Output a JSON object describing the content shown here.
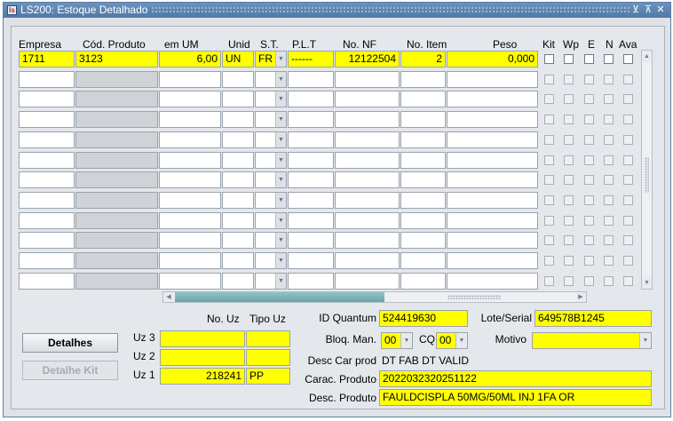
{
  "window": {
    "title": "LS200: Estoque Detalhado",
    "icon_label": "ls"
  },
  "headers": {
    "empresa": "Empresa",
    "cod_produto": "Cód. Produto",
    "em_um": "em UM",
    "unid": "Unid",
    "st": "S.T.",
    "plt": "P.L.T",
    "no_nf": "No. NF",
    "no_item": "No. Item",
    "peso": "Peso",
    "kit": "Kit",
    "wp": "Wp",
    "e": "E",
    "n": "N",
    "ava": "Ava"
  },
  "rows": [
    {
      "empresa": "1711",
      "cod_produto": "3123",
      "em_um": "6,00",
      "unid": "UN",
      "st": "FR",
      "plt": "------",
      "no_nf": "12122504",
      "no_item": "2",
      "peso": "0,000"
    }
  ],
  "bottom": {
    "no_uz_label": "No. Uz",
    "tipo_uz_label": "Tipo Uz",
    "uz3_label": "Uz 3",
    "uz2_label": "Uz 2",
    "uz1_label": "Uz 1",
    "uz1_no": "218241",
    "uz1_tipo": "PP",
    "detalhes_button": "Detalhes",
    "detalhe_kit_button": "Detalhe Kit",
    "id_quantum_label": "ID Quantum",
    "id_quantum": "524419630",
    "lote_serial_label": "Lote/Serial",
    "lote_serial": "649578B1245",
    "bloq_man_label": "Bloq. Man.",
    "bloq_man": "00",
    "cq_label": "CQ",
    "cq": "00",
    "motivo_label": "Motivo",
    "motivo": "",
    "desc_car_prod_label": "Desc Car prod",
    "desc_car_prod": "DT FAB  DT VALID",
    "carac_produto_label": "Carac. Produto",
    "carac_produto": "2022032320251122",
    "desc_produto_label": "Desc. Produto",
    "desc_produto": "FAULDCISPLA 50MG/50ML INJ 1FA OR"
  },
  "colors": {
    "highlight": "#ffff00",
    "titlebar": "#5a82ae",
    "scroll_thumb": "#7fb6b7"
  }
}
